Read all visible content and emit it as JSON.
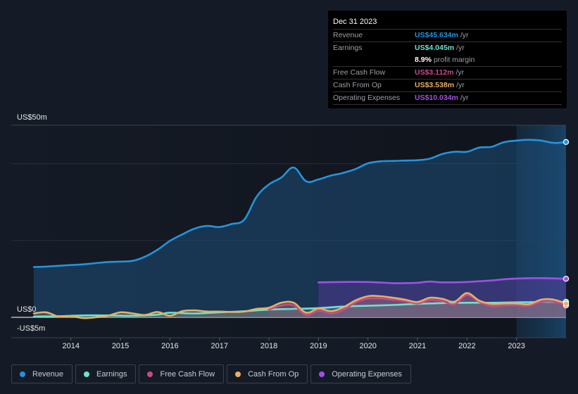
{
  "tooltip": {
    "date": "Dec 31 2023",
    "rows": [
      {
        "label": "Revenue",
        "value": "US$45.634m",
        "unit": "/yr",
        "color": "#2394df"
      },
      {
        "label": "Earnings",
        "value": "US$4.045m",
        "unit": "/yr",
        "color": "#6ce3cf"
      },
      {
        "label": "",
        "value": "8.9%",
        "unit": "profit margin",
        "color": "#ffffff"
      },
      {
        "label": "Free Cash Flow",
        "value": "US$3.112m",
        "unit": "/yr",
        "color": "#c84b89"
      },
      {
        "label": "Cash From Op",
        "value": "US$3.538m",
        "unit": "/yr",
        "color": "#e8b060"
      },
      {
        "label": "Operating Expenses",
        "value": "US$10.034m",
        "unit": "/yr",
        "color": "#a24fe6"
      }
    ]
  },
  "legend": [
    {
      "label": "Revenue",
      "color": "#2394df"
    },
    {
      "label": "Earnings",
      "color": "#6ce3cf"
    },
    {
      "label": "Free Cash Flow",
      "color": "#c84b89"
    },
    {
      "label": "Cash From Op",
      "color": "#e8b060"
    },
    {
      "label": "Operating Expenses",
      "color": "#a24fe6"
    }
  ],
  "chart_data": {
    "type": "area",
    "title": "",
    "xlabel": "",
    "ylabel": "",
    "y_tick_labels": [
      {
        "value": 50,
        "label": "US$50m"
      },
      {
        "value": 0,
        "label": "US$0"
      },
      {
        "value": -5,
        "label": "-US$5m"
      }
    ],
    "x_tick_labels": [
      "2014",
      "2015",
      "2016",
      "2017",
      "2018",
      "2019",
      "2020",
      "2021",
      "2022",
      "2023"
    ],
    "xlim": [
      2013.25,
      2024.0
    ],
    "ylim": [
      -5,
      50
    ],
    "highlight_start": 2023.0,
    "grid": true,
    "legend_position": "bottom-left",
    "series": [
      {
        "name": "Revenue",
        "color": "#2394df",
        "x": [
          2013.25,
          2013.5,
          2013.75,
          2014.0,
          2014.25,
          2014.5,
          2014.75,
          2015.0,
          2015.25,
          2015.5,
          2015.75,
          2016.0,
          2016.25,
          2016.5,
          2016.75,
          2017.0,
          2017.25,
          2017.5,
          2017.75,
          2018.0,
          2018.25,
          2018.5,
          2018.75,
          2019.0,
          2019.25,
          2019.5,
          2019.75,
          2020.0,
          2020.25,
          2020.5,
          2020.75,
          2021.0,
          2021.25,
          2021.5,
          2021.75,
          2022.0,
          2022.25,
          2022.5,
          2022.75,
          2023.0,
          2023.25,
          2023.5,
          2023.75,
          2024.0
        ],
        "values": [
          13.1,
          13.2,
          13.4,
          13.6,
          13.8,
          14.1,
          14.4,
          14.5,
          14.7,
          15.8,
          17.6,
          19.9,
          21.6,
          23.1,
          23.8,
          23.5,
          24.3,
          25.4,
          31.4,
          34.6,
          36.4,
          39.0,
          35.4,
          35.9,
          36.9,
          37.6,
          38.6,
          40.1,
          40.6,
          40.7,
          40.8,
          40.9,
          41.3,
          42.5,
          43.1,
          43.1,
          44.2,
          44.4,
          45.6,
          46.0,
          46.2,
          46.0,
          45.4,
          45.634
        ]
      },
      {
        "name": "Earnings",
        "color": "#6ce3cf",
        "x": [
          2013.25,
          2013.75,
          2014.25,
          2014.75,
          2015.25,
          2015.75,
          2016.0,
          2016.5,
          2017.0,
          2017.5,
          2018.0,
          2018.5,
          2019.0,
          2019.5,
          2020.0,
          2020.5,
          2021.0,
          2021.5,
          2022.0,
          2022.5,
          2023.0,
          2023.5,
          2024.0
        ],
        "values": [
          0.2,
          0.3,
          0.5,
          0.5,
          0.4,
          0.7,
          1.2,
          1.0,
          1.3,
          1.6,
          2.0,
          2.2,
          2.4,
          2.8,
          3.0,
          3.2,
          3.5,
          3.7,
          3.8,
          3.8,
          3.9,
          4.0,
          4.045
        ]
      },
      {
        "name": "Free Cash Flow",
        "color": "#c84b89",
        "x": [
          2018.0,
          2018.25,
          2018.5,
          2018.75,
          2019.0,
          2019.25,
          2019.5,
          2019.75,
          2020.0,
          2020.25,
          2020.5,
          2020.75,
          2021.0,
          2021.25,
          2021.5,
          2021.75,
          2022.0,
          2022.25,
          2022.5,
          2022.75,
          2023.0,
          2023.25,
          2023.5,
          2023.75,
          2024.0
        ],
        "values": [
          2.0,
          3.1,
          3.1,
          0.6,
          1.7,
          1.0,
          1.9,
          3.9,
          4.9,
          4.9,
          4.6,
          4.2,
          3.6,
          4.5,
          4.2,
          3.4,
          5.8,
          4.0,
          2.9,
          3.1,
          3.1,
          3.0,
          4.0,
          4.1,
          3.112
        ]
      },
      {
        "name": "Cash From Op",
        "color": "#e8b060",
        "x": [
          2013.25,
          2013.5,
          2013.75,
          2014.0,
          2014.25,
          2014.5,
          2014.75,
          2015.0,
          2015.25,
          2015.5,
          2015.75,
          2016.0,
          2016.25,
          2016.5,
          2016.75,
          2017.0,
          2017.25,
          2017.5,
          2017.75,
          2018.0,
          2018.25,
          2018.5,
          2018.75,
          2019.0,
          2019.25,
          2019.5,
          2019.75,
          2020.0,
          2020.25,
          2020.5,
          2020.75,
          2021.0,
          2021.25,
          2021.5,
          2021.75,
          2022.0,
          2022.25,
          2022.5,
          2022.75,
          2023.0,
          2023.25,
          2023.5,
          2023.75,
          2024.0
        ],
        "values": [
          1.0,
          1.3,
          0.2,
          0.3,
          -0.2,
          0.0,
          0.4,
          1.3,
          1.0,
          0.6,
          1.4,
          0.4,
          1.6,
          1.8,
          1.5,
          1.5,
          1.4,
          1.5,
          2.2,
          2.5,
          3.8,
          3.8,
          1.2,
          2.3,
          1.6,
          2.6,
          4.4,
          5.5,
          5.5,
          5.1,
          4.6,
          4.0,
          5.1,
          4.8,
          4.1,
          6.3,
          4.3,
          3.5,
          3.6,
          3.6,
          3.4,
          4.6,
          4.6,
          3.538
        ]
      },
      {
        "name": "Operating Expenses",
        "color": "#a24fe6",
        "x": [
          2019.0,
          2019.5,
          2020.0,
          2020.5,
          2020.75,
          2021.0,
          2021.25,
          2021.5,
          2022.0,
          2022.25,
          2022.5,
          2022.75,
          2023.0,
          2023.5,
          2024.0
        ],
        "values": [
          9.1,
          9.2,
          9.2,
          8.9,
          8.9,
          9.0,
          9.3,
          9.1,
          9.2,
          9.4,
          9.6,
          9.9,
          10.1,
          10.2,
          10.034
        ]
      }
    ]
  }
}
